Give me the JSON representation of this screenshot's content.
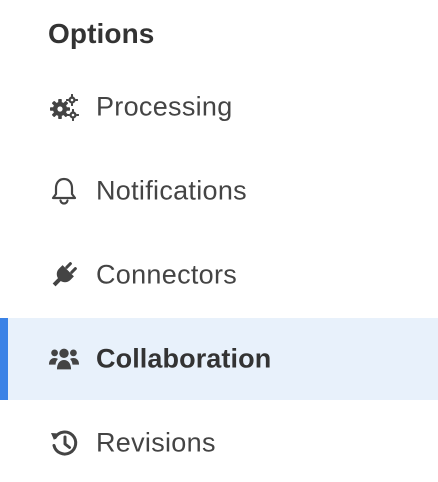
{
  "sidebar": {
    "title": "Options",
    "items": [
      {
        "label": "Processing",
        "icon": "gears-icon"
      },
      {
        "label": "Notifications",
        "icon": "bell-icon"
      },
      {
        "label": "Connectors",
        "icon": "plug-icon"
      },
      {
        "label": "Collaboration",
        "icon": "users-icon",
        "active": true
      },
      {
        "label": "Revisions",
        "icon": "history-icon"
      }
    ]
  },
  "colors": {
    "accent": "#3b82e6",
    "active_background": "#e8f1fb",
    "text": "#444444",
    "title": "#333333"
  }
}
